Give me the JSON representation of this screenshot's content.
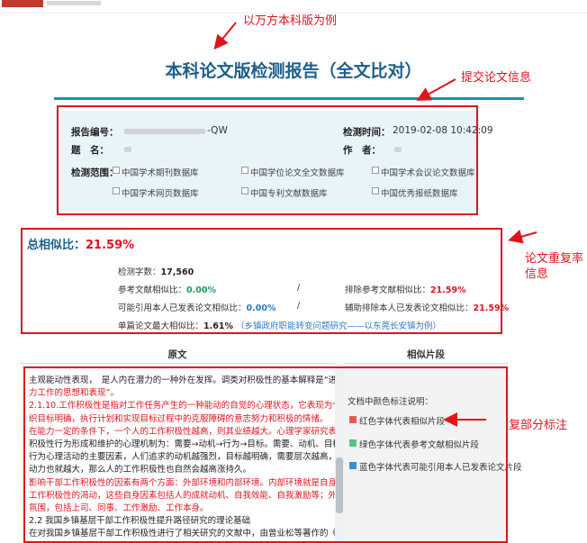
{
  "annotations": {
    "example_note": "以万方本科版为例",
    "submit_info": "提交论文信息",
    "dup_rate_line1": "论文重复率",
    "dup_rate_line2": "信息",
    "marked_parts": "文章重复部分标注"
  },
  "report": {
    "title": "本科论文版检测报告（全文比对）",
    "number_label": "报告编号：",
    "number_suffix": "-QW",
    "time_label": "检测时间：",
    "time_value": "2019-02-08 10:42:09",
    "subject_label": "题　名：",
    "author_label": "作　者：",
    "scope_label": "检测范围：",
    "databases": [
      "中国学术期刊数据库",
      "中国学位论文全文数据库",
      "中国学术会议论文数据库",
      "中国学术网页数据库",
      "中国专利文献数据库",
      "中国优秀报纸数据库"
    ]
  },
  "stats": {
    "total_label": "总相似比：",
    "total_value": "21.59%",
    "word_count_label": "检测字数：",
    "word_count_value": "17,560",
    "ref_label": "参考文献相似比：",
    "ref_value": "0.00%",
    "exclude_ref_label": "排除参考文献相似比：",
    "exclude_ref_value": "21.59%",
    "self_label": "可能引用本人已发表论文相似比：",
    "self_value": "0.00%",
    "exclude_self_label": "辅助排除本人已发表论文相似比：",
    "exclude_self_value": "21.59%",
    "max_label": "单篇论文最大相似比：",
    "max_value": "1.61%",
    "max_source": "（乡镇政府职能转变问题研究——以东莞长安镇为例）",
    "separator": "/"
  },
  "table": {
    "col_original": "原文",
    "col_similar": "相似片段",
    "lines": [
      {
        "text": "主观能动性表现，　是人内在潜力的一种外在发挥。调类对积极性的基本解释是“进取向上、努",
        "red": false
      },
      {
        "text": "力工作的思想和表现”。",
        "red": true
      },
      {
        "text": "2.1.10.工作积极性是指对工作任务产生的一种能动的自觉的心理状态，它表现为个体或集体对组",
        "red": true
      },
      {
        "text": "织目标明确，执行计划和实现目标过程中的克服障碍的意志努力和积极的情绪。",
        "red": true
      },
      {
        "text": "在能力一定的条件下，一个人的工作积极性越高，则其业绩越大。心理学家研究表明，引起人的",
        "red": true
      },
      {
        "text": "积极性行为形成和维护的心理机制为：需要→动机→行为→目标。需要、动机、目标是构成积极性",
        "red": false
      },
      {
        "text": "行为心理活动的主要因素，人们追求的动机越强烈，目标越明确，需要层次越高，其行为的内在",
        "red": false
      },
      {
        "text": "动力也就越大，那么人的工作积极性也自然会越高涨持久。",
        "red": false
      },
      {
        "text": "影响干部工作积极性的因素有两个方面：外部环境和内部环境。内部环境就是自身因素，包括对",
        "red": true
      },
      {
        "text": "工作积极性的渴动，这些自身因素包括人的成就动机、自我效能、自我激励等；外部环境是工作",
        "red": true
      },
      {
        "text": "氛围，包括上司、同事、工作激励、工作本身。",
        "red": true
      },
      {
        "text": "2.2 我国乡镇基层干部工作积极性提升路径研究的理论基础",
        "red": false
      },
      {
        "text": "在对我国乡镇基层干部工作积极性进行了相关研究的文献中，由曾业松等著作的《新时期乡镇干",
        "red": false
      }
    ],
    "legend_title": "文档中颜色标注说明：",
    "legend": [
      {
        "label": "红色字体代表相似片段",
        "color": "#e85a5a"
      },
      {
        "label": "绿色字体代表参考文献相似片段",
        "color": "#5cc08a"
      },
      {
        "label": "蓝色字体代表可能引用本人已发表论文片段",
        "color": "#3d8fd0"
      }
    ]
  }
}
